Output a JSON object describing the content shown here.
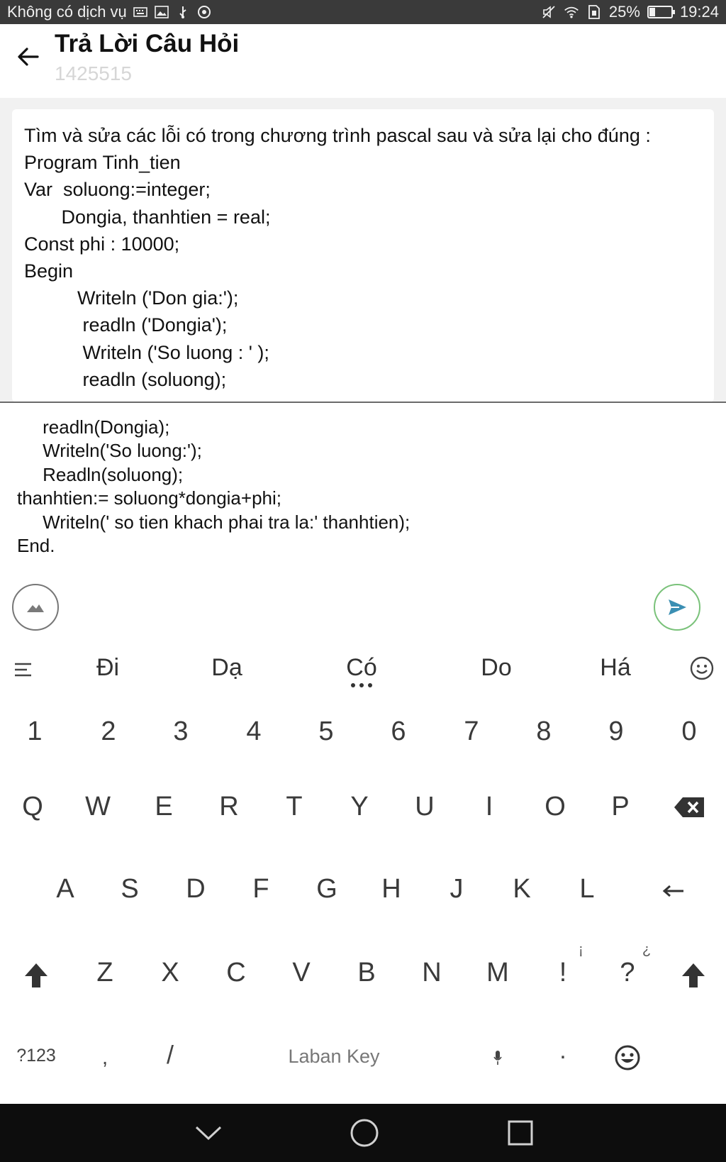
{
  "status_bar": {
    "carrier": "Không có dịch vụ",
    "battery": "25%",
    "battery_level": 0.25,
    "time": "19:24",
    "left_icons": [
      "keyboard-icon",
      "image-icon",
      "usb-icon",
      "chrome-icon"
    ],
    "right_icons": [
      "mute-icon",
      "wifi-icon",
      "sim-icon",
      "battery-icon"
    ]
  },
  "header": {
    "title": "Trả Lời Câu Hỏi",
    "subtitle": "1425515"
  },
  "question": {
    "lines": [
      "Tìm và sửa các lỗi có trong chương trình pascal sau và sửa lại cho đúng :",
      "Program Tinh_tien",
      "Var  soluong:=integer;",
      "       Dongia, thanhtien = real;",
      "Const phi : 10000;",
      "Begin",
      "          Writeln ('Don gia:');",
      "           readln ('Dongia');",
      "           Writeln ('So luong : ' );",
      "           readln (soluong);"
    ]
  },
  "answer": {
    "lines": [
      "     readln(Dongia);",
      "     Writeln('So luong:');",
      "     Readln(soluong);",
      "thanhtien:= soluong*dongia+phi;",
      "     Writeln(' so tien khach phai tra la:' thanhtien);",
      "End."
    ]
  },
  "keyboard": {
    "suggestions": [
      "Đi",
      "Dạ",
      "Có",
      "Do",
      "Há"
    ],
    "numbers": [
      "1",
      "2",
      "3",
      "4",
      "5",
      "6",
      "7",
      "8",
      "9",
      "0"
    ],
    "row_q": [
      "Q",
      "W",
      "E",
      "R",
      "T",
      "Y",
      "U",
      "I",
      "O",
      "P"
    ],
    "row_a": [
      "A",
      "S",
      "D",
      "F",
      "G",
      "H",
      "J",
      "K",
      "L"
    ],
    "row_z": [
      "Z",
      "X",
      "C",
      "V",
      "B",
      "N",
      "M",
      "!",
      "?"
    ],
    "sup_excl": "¡",
    "sup_question": "¿",
    "symbols_key": "?123",
    "comma_key": ",",
    "slash_key": "/",
    "space_label": "Laban Key",
    "period_key": "."
  }
}
